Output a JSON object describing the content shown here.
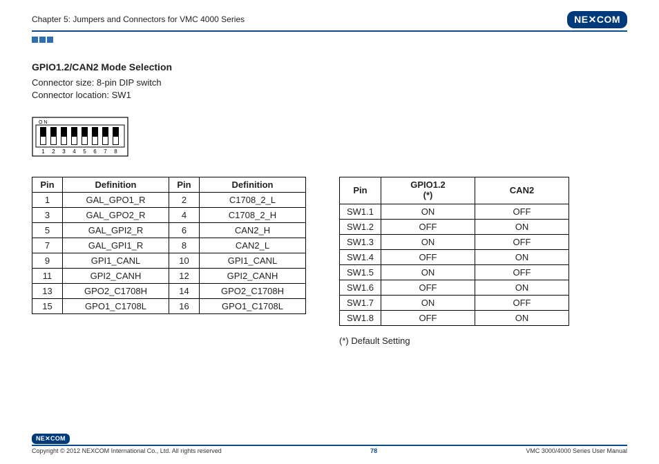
{
  "header": {
    "chapter": "Chapter 5: Jumpers and Connectors for VMC 4000 Series",
    "logo_left": "NE",
    "logo_right": "COM"
  },
  "section": {
    "title": "GPIO1.2/CAN2 Mode Selection",
    "size": "Connector size: 8-pin DIP switch",
    "location": "Connector location: SW1"
  },
  "dip": {
    "on_label": "O N",
    "numbers": [
      "1",
      "2",
      "3",
      "4",
      "5",
      "6",
      "7",
      "8"
    ]
  },
  "table1": {
    "headers": [
      "Pin",
      "Definition",
      "Pin",
      "Definition"
    ],
    "rows": [
      [
        "1",
        "GAL_GPO1_R",
        "2",
        "C1708_2_L"
      ],
      [
        "3",
        "GAL_GPO2_R",
        "4",
        "C1708_2_H"
      ],
      [
        "5",
        "GAL_GPI2_R",
        "6",
        "CAN2_H"
      ],
      [
        "7",
        "GAL_GPI1_R",
        "8",
        "CAN2_L"
      ],
      [
        "9",
        "GPI1_CANL",
        "10",
        "GPI1_CANL"
      ],
      [
        "11",
        "GPI2_CANH",
        "12",
        "GPI2_CANH"
      ],
      [
        "13",
        "GPO2_C1708H",
        "14",
        "GPO2_C1708H"
      ],
      [
        "15",
        "GPO1_C1708L",
        "16",
        "GPO1_C1708L"
      ]
    ]
  },
  "table2": {
    "headers": [
      "Pin",
      "GPIO1.2\n(*)",
      "CAN2"
    ],
    "rows": [
      [
        "SW1.1",
        "ON",
        "OFF"
      ],
      [
        "SW1.2",
        "OFF",
        "ON"
      ],
      [
        "SW1.3",
        "ON",
        "OFF"
      ],
      [
        "SW1.4",
        "OFF",
        "ON"
      ],
      [
        "SW1.5",
        "ON",
        "OFF"
      ],
      [
        "SW1.6",
        "OFF",
        "ON"
      ],
      [
        "SW1.7",
        "ON",
        "OFF"
      ],
      [
        "SW1.8",
        "OFF",
        "ON"
      ]
    ],
    "note": "(*) Default Setting"
  },
  "footer": {
    "logo_left": "NE",
    "logo_right": "COM",
    "copyright": "Copyright © 2012 NEXCOM International Co., Ltd. All rights reserved",
    "page": "78",
    "manual": "VMC 3000/4000 Series User Manual"
  }
}
